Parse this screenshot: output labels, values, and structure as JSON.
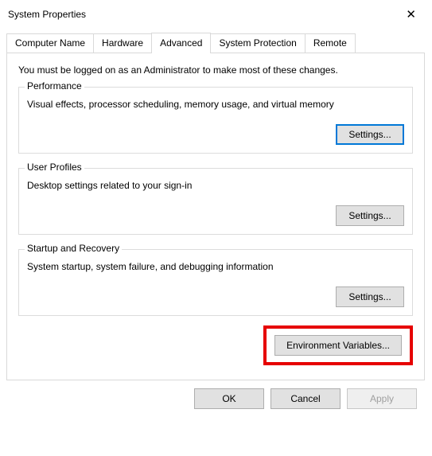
{
  "window": {
    "title": "System Properties"
  },
  "tabs": {
    "computer_name": "Computer Name",
    "hardware": "Hardware",
    "advanced": "Advanced",
    "system_protection": "System Protection",
    "remote": "Remote"
  },
  "advanced_panel": {
    "intro": "You must be logged on as an Administrator to make most of these changes.",
    "performance": {
      "title": "Performance",
      "text": "Visual effects, processor scheduling, memory usage, and virtual memory",
      "button": "Settings..."
    },
    "user_profiles": {
      "title": "User Profiles",
      "text": "Desktop settings related to your sign-in",
      "button": "Settings..."
    },
    "startup_recovery": {
      "title": "Startup and Recovery",
      "text": "System startup, system failure, and debugging information",
      "button": "Settings..."
    },
    "environment_variables_button": "Environment Variables..."
  },
  "buttons": {
    "ok": "OK",
    "cancel": "Cancel",
    "apply": "Apply"
  }
}
